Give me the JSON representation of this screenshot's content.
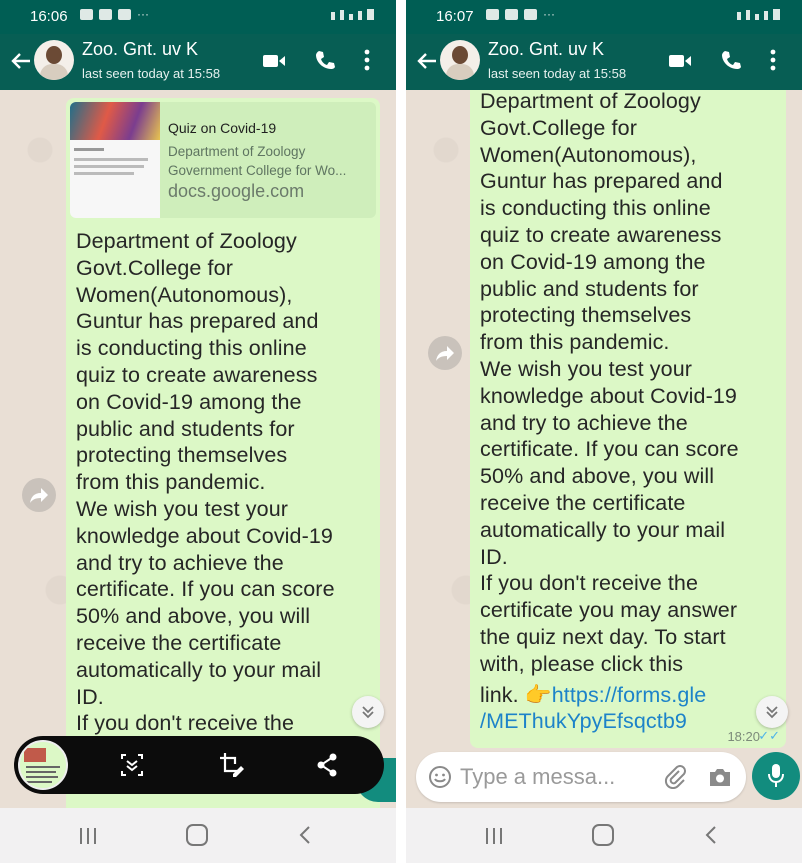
{
  "colors": {
    "header": "#075e54",
    "status_bar": "#005e54",
    "bubble": "#dcf8c6",
    "chat_background": "#e9dfd5",
    "link": "#1d83c9",
    "fab": "#128c7e"
  },
  "left": {
    "status_time": "16:06",
    "status_dots": "···",
    "chat": {
      "name": "Zoo. Gnt. uv K",
      "last_seen": "last seen today at 15:58"
    },
    "link_preview": {
      "title": "Quiz on Covid-19",
      "desc_line1": "Department of Zoology",
      "desc_line2": "Government College for Wo...",
      "domain": "docs.google.com"
    },
    "message_lines": [
      "Department of Zoology",
      "Govt.College for",
      "Women(Autonomous),",
      "Guntur has prepared and",
      "is conducting this online",
      "quiz to create awareness",
      "on Covid-19 among the",
      "public and students for",
      "protecting themselves",
      "from this pandemic.",
      "We wish you test your",
      "knowledge about Covid-19",
      "and try to achieve the",
      "certificate. If you can score",
      "50% and above, you will",
      "receive the certificate",
      "automatically to your mail",
      "ID.",
      "If you don't receive the"
    ],
    "toolbar_icons": [
      "scroll-capture-icon",
      "crop-edit-icon",
      "share-icon"
    ]
  },
  "right": {
    "status_time": "16:07",
    "status_dots": "···",
    "chat": {
      "name": "Zoo. Gnt. uv K",
      "last_seen": "last seen today at 15:58"
    },
    "message_lines": [
      "Department of Zoology",
      "Govt.College for",
      "Women(Autonomous),",
      "Guntur has prepared and",
      "is conducting this online",
      "quiz to create awareness",
      "on Covid-19 among the",
      "public and students for",
      "protecting themselves",
      "from this pandemic.",
      "We wish you test your",
      "knowledge about Covid-19",
      "and try to achieve the",
      "certificate. If you can score",
      "50% and above, you will",
      "receive the certificate",
      "automatically to your mail",
      "ID.",
      "If you don't receive the",
      "certificate you may answer",
      "the quiz  next day. To start",
      "with, please click this"
    ],
    "link_prefix": "link. ",
    "pointer_emoji": "👉",
    "link_url_line1": "https://forms.gle",
    "link_url_line2": "/METhukYpyEfsqctb9",
    "message_time": "18:20",
    "read_ticks": "✓✓",
    "composer": {
      "placeholder": "Type a messa..."
    }
  }
}
